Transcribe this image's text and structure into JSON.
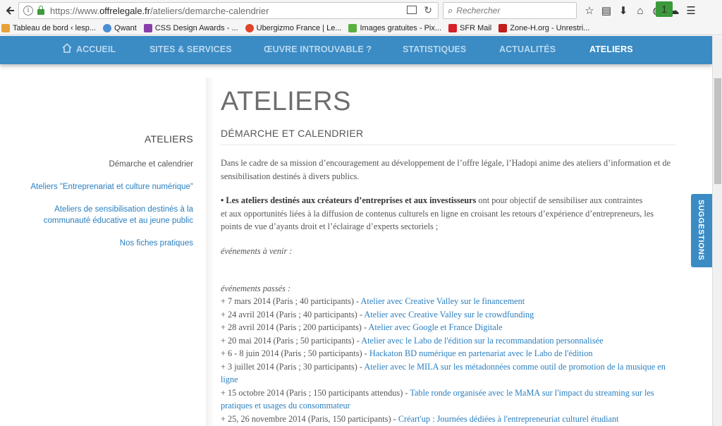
{
  "browser": {
    "url_prefix": "https://www.",
    "url_domain": "offrelegale.fr",
    "url_path": "/ateliers/demarche-calendrier",
    "search_placeholder": "Rechercher",
    "addon_badge": "1"
  },
  "bookmarks": [
    {
      "label": "Tableau de bord ‹ lesp...",
      "color": "#e8a13a"
    },
    {
      "label": "Qwant",
      "color": "#4a8fd4"
    },
    {
      "label": "CSS Design Awards - ...",
      "color": "#8a3ea8"
    },
    {
      "label": "Ubergizmo France | Le...",
      "color": "#e0452a"
    },
    {
      "label": "Images gratuites - Pix...",
      "color": "#5ab040"
    },
    {
      "label": "SFR Mail",
      "color": "#d61f26"
    },
    {
      "label": "Zone-H.org - Unrestri...",
      "color": "#c31c1c"
    }
  ],
  "nav": [
    {
      "label": "ACCUEIL"
    },
    {
      "label": "SITES & SERVICES"
    },
    {
      "label": "ŒUVRE INTROUVABLE ?"
    },
    {
      "label": "STATISTIQUES"
    },
    {
      "label": "ACTUALITÉS"
    },
    {
      "label": "ATELIERS"
    }
  ],
  "sidebar": {
    "heading": "ATELIERS",
    "links": [
      {
        "label": "Démarche et calendrier"
      },
      {
        "label": "Ateliers \"Entreprenariat et culture numérique\""
      },
      {
        "label_line1": "Ateliers de sensibilisation destinés à la",
        "label_line2": "communauté éducative et au jeune public"
      },
      {
        "label": "Nos fiches pratiques"
      }
    ]
  },
  "main": {
    "title": "ATELIERS",
    "subtitle": "DÉMARCHE ET CALENDRIER",
    "intro_line1": "Dans le cadre de sa mission d’encouragement au développement de l’offre légale, l’Hadopi anime des ateliers d’information et de",
    "intro_line2": "sensibilisation destinés à divers publics.",
    "bullet_bold": "• Les ateliers destinés aux créateurs d’entreprises et aux investisseurs",
    "bullet_rest1": " ont pour objectif de sensibiliser aux contraintes",
    "bullet_line2": "et aux opportunités liées à la diffusion de contenus culturels en ligne en croisant les retours d’expérience d’entrepreneurs, les",
    "bullet_line3": "points de vue d’ayants droit et l’éclairage d’experts sectoriels ;",
    "upcoming_label": "événements à venir :",
    "past_label": "événements passés :",
    "events": [
      {
        "date": "+ 7 mars 2014 (Paris ; 40 participants) - ",
        "link": " Atelier avec Creative Valley sur le financement"
      },
      {
        "date": "+ 24 avril 2014 (Paris ; 40 participants) - ",
        "link": "Atelier avec Creative Valley sur le crowdfunding"
      },
      {
        "date": "+ 28 avril 2014 (Paris ; 200 participants) - ",
        "link": "Atelier avec Google et France Digitale"
      },
      {
        "date": "+ 20 mai 2014 (Paris ; 50 participants) - ",
        "link": "Atelier avec le Labo de l'édition sur la recommandation personnalisée"
      },
      {
        "date": "+ 6 - 8 juin 2014 (Paris ; 50 participants) - ",
        "link": "Hackaton BD numérique en partenariat avec le Labo de l'édition"
      },
      {
        "date": "+ 3 juillet 2014 (Paris ; 30 participants) - ",
        "link": "Atelier avec le MILA sur les métadonnées comme outil de promotion de la musique en",
        "link2": "ligne"
      },
      {
        "date": "+ 15 octobre 2014 (Paris ; 150 participants attendus) - ",
        "link": "Table ronde organisée avec le MaMA sur l'impact du streaming sur les",
        "link2": "pratiques et usages du consommateur"
      },
      {
        "date": "+ 25, 26 novembre 2014 (Paris, 150 participants) - ",
        "link": "Créart'up : Journées dédiées à l'entrepreneuriat culturel étudiant"
      }
    ]
  },
  "suggestions_label": "SUGGESTIONS"
}
